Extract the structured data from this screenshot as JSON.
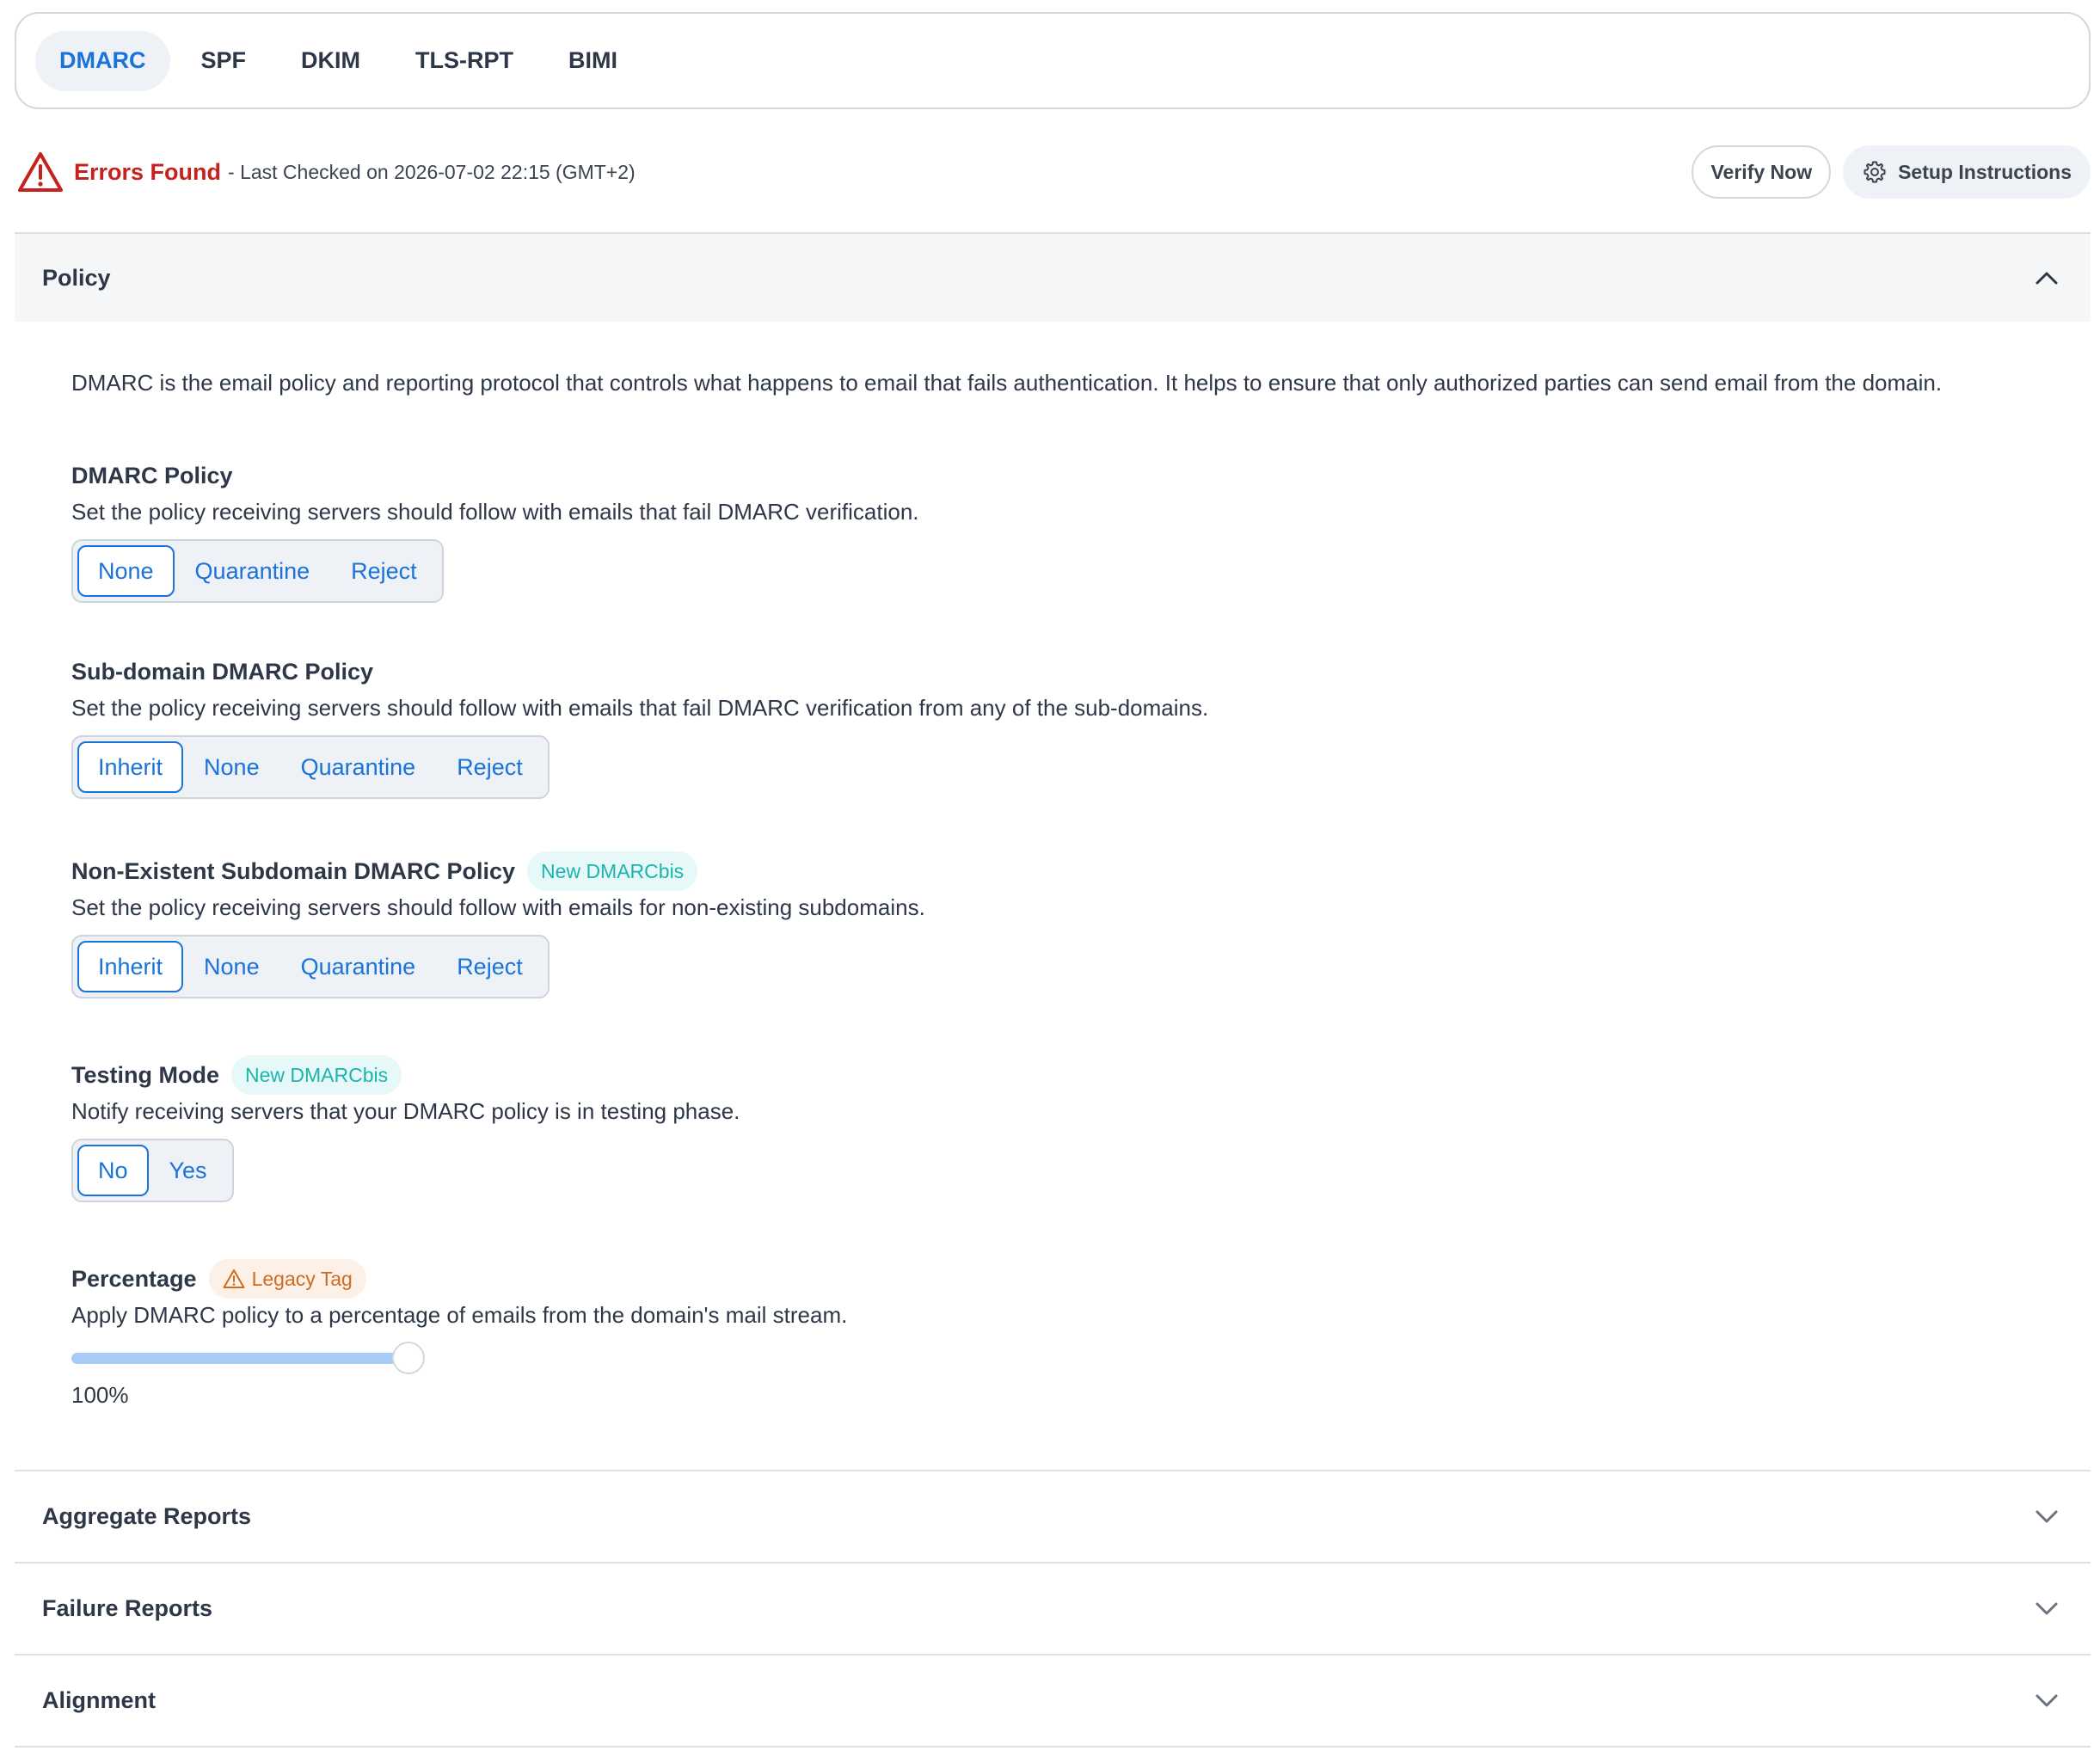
{
  "tabs": [
    {
      "label": "DMARC",
      "active": true
    },
    {
      "label": "SPF",
      "active": false
    },
    {
      "label": "DKIM",
      "active": false
    },
    {
      "label": "TLS-RPT",
      "active": false
    },
    {
      "label": "BIMI",
      "active": false
    }
  ],
  "status": {
    "label": "Errors Found",
    "meta": "- Last Checked on 2026-07-02 22:15 (GMT+2)",
    "verify_label": "Verify Now",
    "setup_label": "Setup Instructions",
    "error_color": "#c5221f"
  },
  "policy_section": {
    "title": "Policy",
    "intro": "DMARC is the email policy and reporting protocol that controls what happens to email that fails authentication. It helps to ensure that only authorized parties can send email from the domain.",
    "dmarc_policy": {
      "title": "DMARC Policy",
      "desc": "Set the policy receiving servers should follow with emails that fail DMARC verification.",
      "options": [
        "None",
        "Quarantine",
        "Reject"
      ],
      "selected": "None"
    },
    "subdomain_policy": {
      "title": "Sub-domain DMARC Policy",
      "desc": "Set the policy receiving servers should follow with emails that fail DMARC verification from any of the sub-domains.",
      "options": [
        "Inherit",
        "None",
        "Quarantine",
        "Reject"
      ],
      "selected": "Inherit"
    },
    "nonexistent_policy": {
      "title": "Non-Existent Subdomain DMARC Policy",
      "badge": "New DMARCbis",
      "desc": "Set the policy receiving servers should follow with emails for non-existing subdomains.",
      "options": [
        "Inherit",
        "None",
        "Quarantine",
        "Reject"
      ],
      "selected": "Inherit"
    },
    "testing_mode": {
      "title": "Testing Mode",
      "badge": "New DMARCbis",
      "desc": "Notify receiving servers that your DMARC policy is in testing phase.",
      "options": [
        "No",
        "Yes"
      ],
      "selected": "No"
    },
    "percentage": {
      "title": "Percentage",
      "badge": "Legacy Tag",
      "desc": "Apply DMARC policy to a percentage of emails from the domain's mail stream.",
      "value": 100,
      "value_label": "100%"
    }
  },
  "collapsed_sections": [
    {
      "title": "Aggregate Reports"
    },
    {
      "title": "Failure Reports"
    },
    {
      "title": "Alignment"
    }
  ],
  "colors": {
    "accent": "#1a73d9",
    "badge_new": "#1bb4ae",
    "badge_legacy": "#d06b1f"
  }
}
